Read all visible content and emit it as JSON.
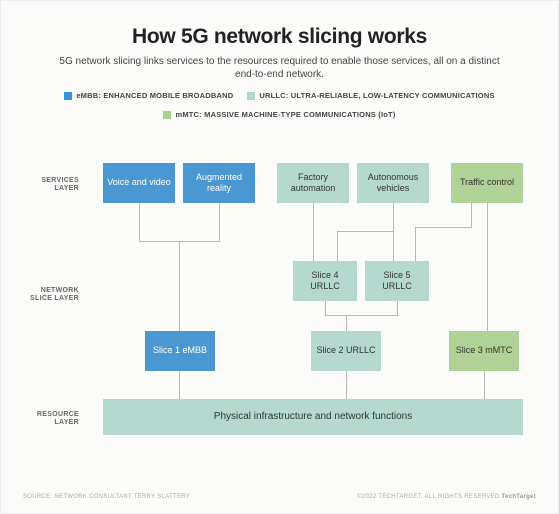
{
  "title": "How 5G network slicing works",
  "subtitle": "5G network slicing links services to the resources required to enable those services, all on a distinct end-to-end network.",
  "legend": {
    "embb": "eMBB: ENHANCED MOBILE BROADBAND",
    "urllc": "URLLC: ULTRA-RELIABLE, LOW-LATENCY COMMUNICATIONS",
    "mmtc": "mMTC: MASSIVE MACHINE-TYPE COMMUNICATIONS (IoT)"
  },
  "rows": {
    "services": "SERVICES LAYER",
    "slice": "NETWORK SLICE LAYER",
    "resource": "RESOURCE LAYER"
  },
  "services": {
    "voice": "Voice and video",
    "ar": "Augmented reality",
    "factory": "Factory automation",
    "av": "Autonomous vehicles",
    "traffic": "Traffic control"
  },
  "slices": {
    "s4": "Slice 4 URLLC",
    "s5": "Slice 5 URLLC",
    "s1": "Slice 1 eMBB",
    "s2": "Slice 2 URLLC",
    "s3": "Slice 3 mMTC"
  },
  "resource": "Physical infrastructure and network functions",
  "footer": {
    "source": "SOURCE: NETWORK CONSULTANT TERRY SLATTERY",
    "copyright": "©2022 TECHTARGET, ALL RIGHTS RESERVED",
    "brand": "TechTarget"
  }
}
